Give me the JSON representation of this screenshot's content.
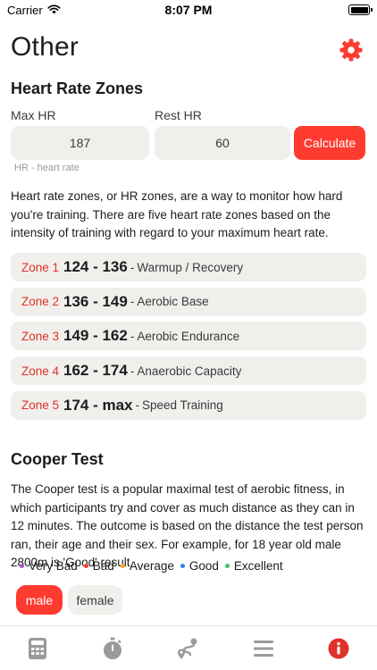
{
  "status_bar": {
    "carrier": "Carrier",
    "time": "8:07 PM"
  },
  "header": {
    "title": "Other",
    "settings_icon": "gear-icon",
    "accent_color": "#ff3b30"
  },
  "heart_rate": {
    "section_title": "Heart Rate Zones",
    "max_hr_label": "Max HR",
    "max_hr_value": "187",
    "rest_hr_label": "Rest HR",
    "rest_hr_value": "60",
    "calculate_label": "Calculate",
    "hint": "HR - heart rate",
    "description": "Heart rate zones, or HR zones, are a way to monitor how hard you're training. There are five heart rate zones based on the intensity of training with regard to your maximum heart rate.",
    "zones": [
      {
        "name": "Zone 1",
        "range": "124 - 136",
        "sep": "-",
        "desc": "Warmup / Recovery"
      },
      {
        "name": "Zone 2",
        "range": "136 - 149",
        "sep": "-",
        "desc": "Aerobic Base"
      },
      {
        "name": "Zone 3",
        "range": "149 - 162",
        "sep": "-",
        "desc": "Aerobic Endurance"
      },
      {
        "name": "Zone 4",
        "range": "162 - 174",
        "sep": "-",
        "desc": "Anaerobic Capacity"
      },
      {
        "name": "Zone 5",
        "range": "174 - max",
        "sep": "-",
        "desc": "Speed Training"
      }
    ]
  },
  "cooper": {
    "section_title": "Cooper Test",
    "description": "The Cooper test is a popular maximal test of aerobic fitness, in which participants try and cover as much distance as they can in 12 minutes. The outcome is based on the distance the test person ran, their age and their sex. For example, for 18 year old male 2800m is 'Good' result.",
    "legend": [
      {
        "label": "Very Bad",
        "color": "#a855c8"
      },
      {
        "label": "Bad",
        "color": "#ff3b30"
      },
      {
        "label": "Average",
        "color": "#f5a623"
      },
      {
        "label": "Good",
        "color": "#2f80ed"
      },
      {
        "label": "Excellent",
        "color": "#34c759"
      }
    ],
    "sex_options": [
      "male",
      "female"
    ],
    "selected_sex": "male"
  },
  "tab_bar": {
    "tabs": [
      "calculator-icon",
      "stopwatch-icon",
      "route-icon",
      "list-icon",
      "info-icon"
    ],
    "active_tab": "info-icon",
    "inactive_color": "#9a9a9e"
  }
}
